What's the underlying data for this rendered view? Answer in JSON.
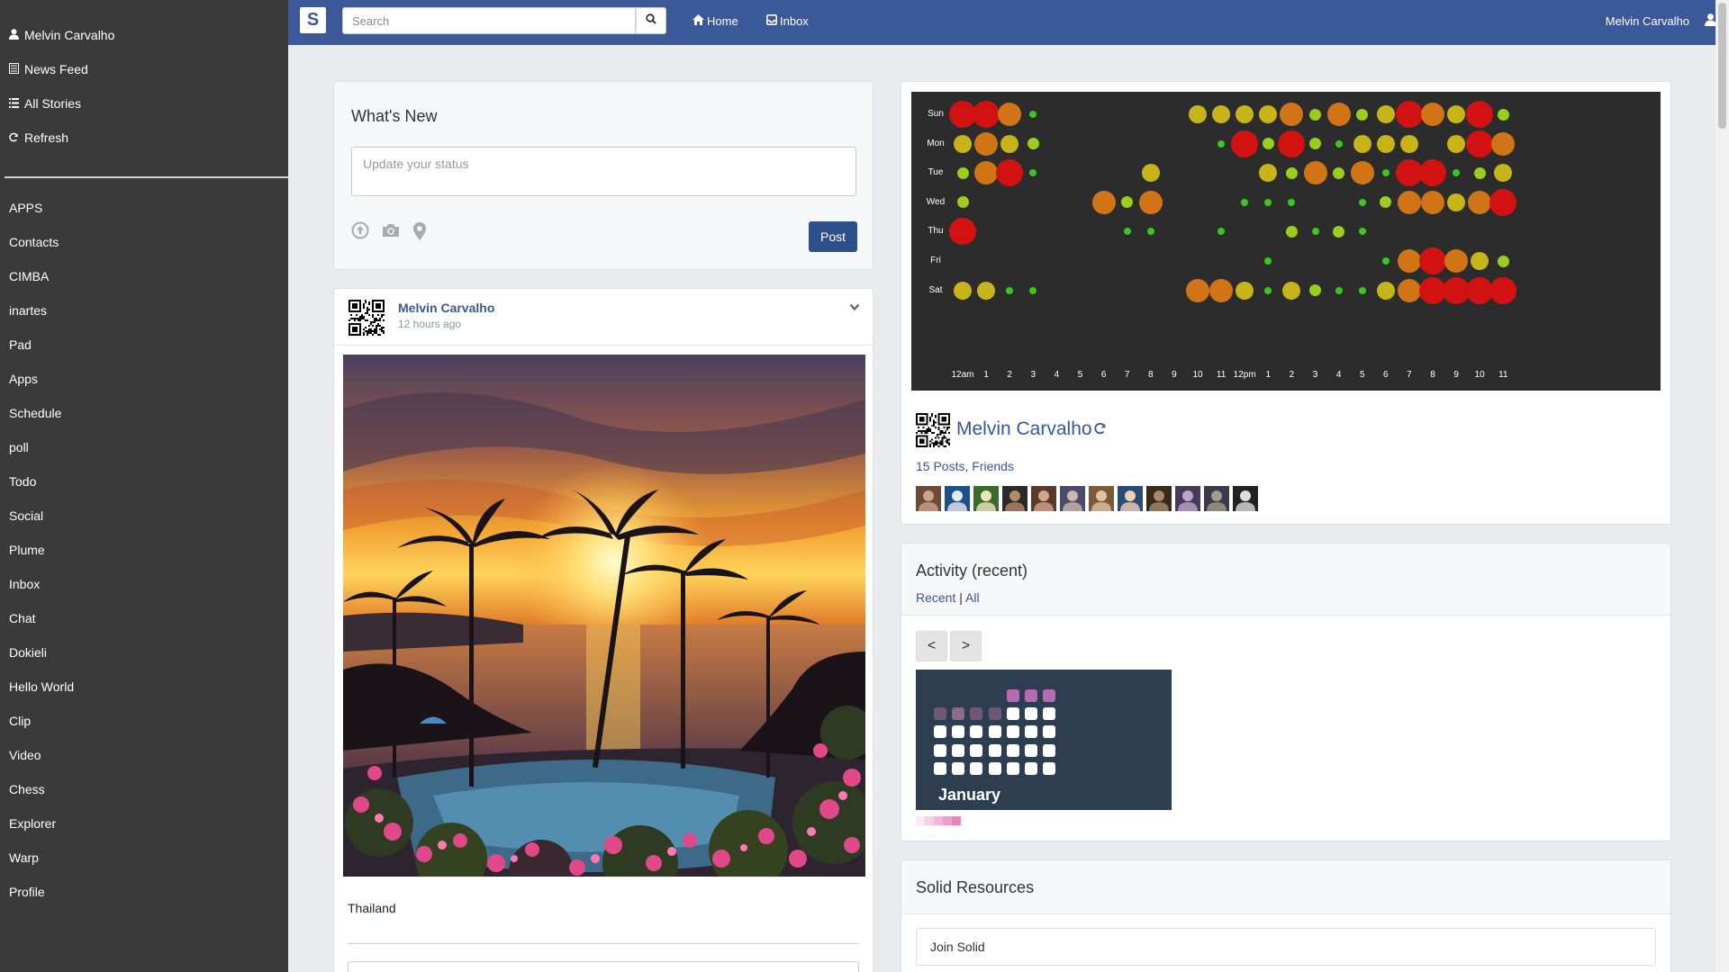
{
  "sidebar": {
    "top_links": [
      {
        "label": "Melvin Carvalho",
        "icon": "user-icon"
      },
      {
        "label": "News Feed",
        "icon": "newspaper-icon"
      },
      {
        "label": "All Stories",
        "icon": "list-icon"
      },
      {
        "label": "Refresh",
        "icon": "refresh-icon"
      }
    ],
    "apps": [
      "APPS",
      "Contacts",
      "CIMBA",
      "inartes",
      "Pad",
      "Apps",
      "Schedule",
      "poll",
      "Todo",
      "Social",
      "Plume",
      "Inbox",
      "Chat",
      "Dokieli",
      "Hello World",
      "Clip",
      "Video",
      "Chess",
      "Explorer",
      "Warp",
      "Profile"
    ]
  },
  "topbar": {
    "brand": "S",
    "search_placeholder": "Search",
    "home_label": "Home",
    "inbox_label": "Inbox",
    "user_name": "Melvin Carvalho",
    "accent_color": "#3b5998"
  },
  "whats_new": {
    "title": "What's New",
    "status_placeholder": "Update your status",
    "post_label": "Post"
  },
  "post": {
    "author": "Melvin Carvalho",
    "time": "12 hours ago",
    "caption": "Thailand"
  },
  "profile": {
    "name": "Melvin Carvalho",
    "posts_link": "15 Posts",
    "friends_link": "Friends",
    "heatmap_days": [
      "Sun",
      "Mon",
      "Tue",
      "Wed",
      "Thu",
      "Fri",
      "Sat"
    ],
    "heatmap_hours": [
      "12am",
      "1",
      "2",
      "3",
      "4",
      "5",
      "6",
      "7",
      "8",
      "9",
      "10",
      "11",
      "12pm",
      "1",
      "2",
      "3",
      "4",
      "5",
      "6",
      "7",
      "8",
      "9",
      "10",
      "11"
    ],
    "heatmap_levels": [
      [
        5,
        5,
        4,
        1,
        0,
        0,
        0,
        0,
        0,
        0,
        3,
        3,
        3,
        3,
        4,
        2,
        4,
        2,
        3,
        5,
        4,
        3,
        5,
        2
      ],
      [
        3,
        4,
        3,
        2,
        0,
        0,
        0,
        0,
        0,
        0,
        0,
        1,
        5,
        2,
        5,
        2,
        1,
        3,
        3,
        3,
        0,
        3,
        5,
        4
      ],
      [
        2,
        4,
        5,
        1,
        0,
        0,
        0,
        0,
        3,
        0,
        0,
        0,
        0,
        3,
        2,
        4,
        2,
        4,
        1,
        5,
        5,
        1,
        2,
        3
      ],
      [
        2,
        0,
        0,
        0,
        0,
        0,
        4,
        2,
        4,
        0,
        0,
        0,
        1,
        1,
        1,
        0,
        0,
        1,
        2,
        4,
        4,
        3,
        4,
        5
      ],
      [
        5,
        0,
        0,
        0,
        0,
        0,
        0,
        1,
        1,
        0,
        0,
        1,
        0,
        0,
        2,
        1,
        2,
        1,
        0,
        0,
        0,
        0,
        0,
        0
      ],
      [
        0,
        0,
        0,
        0,
        0,
        0,
        0,
        0,
        0,
        0,
        0,
        0,
        0,
        1,
        0,
        0,
        0,
        0,
        1,
        4,
        5,
        4,
        3,
        2
      ],
      [
        3,
        3,
        1,
        1,
        0,
        0,
        0,
        0,
        0,
        0,
        4,
        4,
        3,
        1,
        3,
        2,
        1,
        1,
        3,
        4,
        5,
        5,
        5,
        5
      ]
    ],
    "friend_count": 12
  },
  "activity": {
    "title": "Activity (recent)",
    "recent_link": "Recent",
    "all_link": "All",
    "separator": "|",
    "prev_label": "<",
    "next_label": ">",
    "month": "January"
  },
  "resources": {
    "title": "Solid Resources",
    "items": [
      "Join Solid"
    ]
  }
}
